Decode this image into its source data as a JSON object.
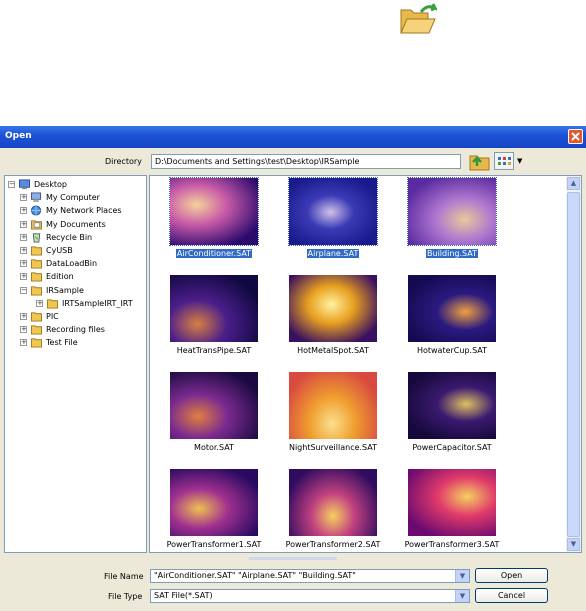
{
  "window": {
    "title": "Open"
  },
  "directory": {
    "label": "Directory",
    "value": "D:\\Documents and Settings\\test\\Desktop\\IRSample"
  },
  "tree": [
    {
      "label": "Desktop",
      "icon": "desktop-icon",
      "level": 0,
      "expander": "−"
    },
    {
      "label": "My Computer",
      "icon": "computer-icon",
      "level": 1,
      "expander": "+"
    },
    {
      "label": "My Network Places",
      "icon": "network-icon",
      "level": 1,
      "expander": "+"
    },
    {
      "label": "My Documents",
      "icon": "documents-icon",
      "level": 1,
      "expander": "+"
    },
    {
      "label": "Recycle Bin",
      "icon": "recycle-bin-icon",
      "level": 1,
      "expander": "+"
    },
    {
      "label": "CyUSB",
      "icon": "folder-icon",
      "level": 1,
      "expander": "+"
    },
    {
      "label": "DataLoadBin",
      "icon": "folder-icon",
      "level": 1,
      "expander": "+"
    },
    {
      "label": "Edition",
      "icon": "folder-icon",
      "level": 1,
      "expander": "+"
    },
    {
      "label": "IRSample",
      "icon": "folder-icon",
      "level": 1,
      "expander": "−"
    },
    {
      "label": "IRTSampleIRT_IRT",
      "icon": "folder-icon",
      "level": 2,
      "expander": "+"
    },
    {
      "label": "PIC",
      "icon": "folder-icon",
      "level": 1,
      "expander": "+"
    },
    {
      "label": "Recording files",
      "icon": "folder-icon",
      "level": 1,
      "expander": "+"
    },
    {
      "label": "Test File",
      "icon": "folder-icon",
      "level": 1,
      "expander": "+"
    }
  ],
  "files": [
    {
      "name": "AirConditioner.SAT",
      "selected": true,
      "palette": [
        "#2b0a6e",
        "#c85aa8",
        "#f5d29a"
      ]
    },
    {
      "name": "Airplane.SAT",
      "selected": true,
      "palette": [
        "#1a1a8c",
        "#3a3ab5",
        "#d0c2e8"
      ]
    },
    {
      "name": "Building.SAT",
      "selected": true,
      "palette": [
        "#5a2aa0",
        "#b078d0",
        "#e8c89a"
      ]
    },
    {
      "name": "HeatTransPipe.SAT",
      "selected": false,
      "palette": [
        "#100840",
        "#4a1e8a",
        "#d88040"
      ]
    },
    {
      "name": "HotMetalSpot.SAT",
      "selected": false,
      "palette": [
        "#3a1060",
        "#e8a020",
        "#fff2a0"
      ]
    },
    {
      "name": "HotwaterCup.SAT",
      "selected": false,
      "palette": [
        "#140a50",
        "#2a1a80",
        "#f0a040"
      ]
    },
    {
      "name": "Motor.SAT",
      "selected": false,
      "palette": [
        "#1a0a40",
        "#7a2a90",
        "#e08040"
      ]
    },
    {
      "name": "NightSurveillance.SAT",
      "selected": false,
      "palette": [
        "#d84a40",
        "#f0a030",
        "#fae090"
      ]
    },
    {
      "name": "PowerCapacitor.SAT",
      "selected": false,
      "palette": [
        "#16083a",
        "#3a1a70",
        "#e0c060"
      ]
    },
    {
      "name": "PowerTransformer1.SAT",
      "selected": false,
      "palette": [
        "#280a60",
        "#a03090",
        "#f0c050"
      ]
    },
    {
      "name": "PowerTransformer2.SAT",
      "selected": false,
      "palette": [
        "#300c60",
        "#c04080",
        "#f8d060"
      ]
    },
    {
      "name": "PowerTransformer3.SAT",
      "selected": false,
      "palette": [
        "#6a0a70",
        "#e03a6a",
        "#f4d060"
      ]
    }
  ],
  "file_name": {
    "label": "File Name",
    "value": "\"AirConditioner.SAT\" \"Airplane.SAT\" \"Building.SAT\""
  },
  "file_type": {
    "label": "File Type",
    "value": "SAT File(*.SAT)"
  },
  "buttons": {
    "open": "Open",
    "cancel": "Cancel"
  }
}
